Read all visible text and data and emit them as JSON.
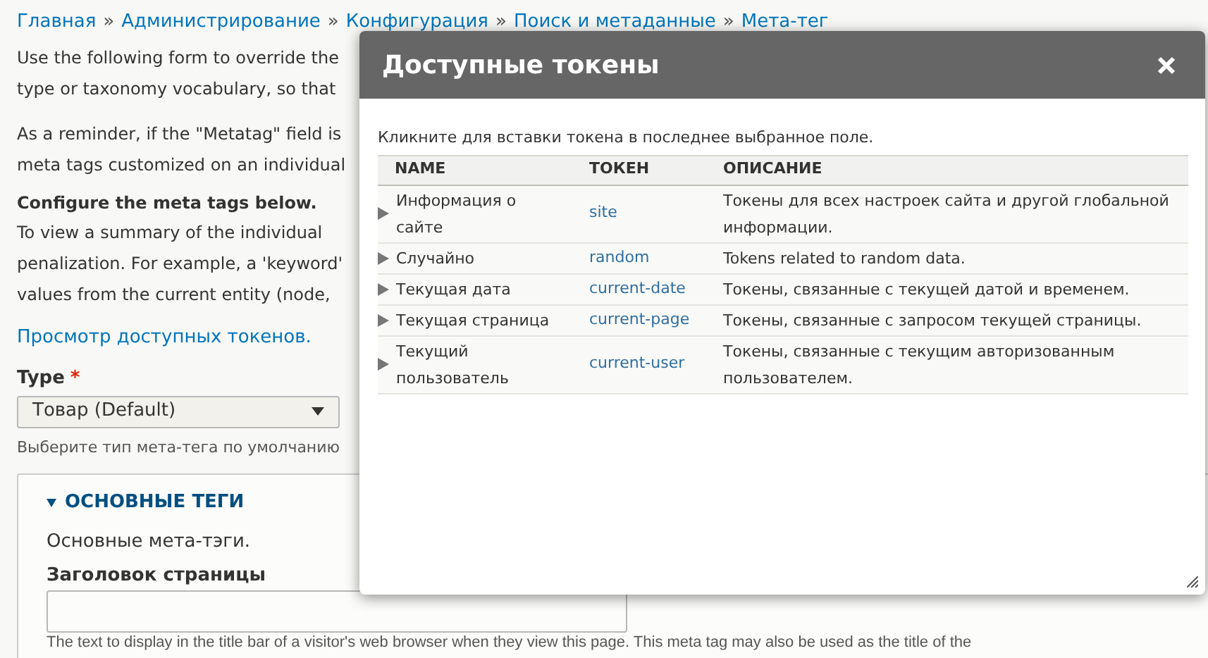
{
  "breadcrumb": [
    {
      "label": "Главная"
    },
    {
      "label": "Администрирование"
    },
    {
      "label": "Конфигурация"
    },
    {
      "label": "Поиск и метаданные"
    },
    {
      "label": "Мета-тег"
    }
  ],
  "breadcrumb_separator": "»",
  "intro_paragraphs": [
    {
      "lines": [
        "Use the following form to override the",
        "type or taxonomy vocabulary, so that"
      ]
    },
    {
      "lines": [
        "As a reminder, if the \"Metatag\" field is",
        "meta tags customized on an individual"
      ]
    }
  ],
  "configure": {
    "heading": "Configure the meta tags below.",
    "lines": [
      "To view a summary of the individual",
      "penalization. For example, a 'keyword'",
      "values from the current entity (node,"
    ]
  },
  "tokens_link": "Просмотр доступных токенов.",
  "type_field": {
    "label": "Type",
    "required": true,
    "required_mark": "*",
    "value": "Товар (Default)",
    "hint": "Выберите тип мета-тега по умолчанию"
  },
  "details": {
    "title": "ОСНОВНЫЕ ТЕГИ",
    "expanded": true,
    "description": "Основные мета-тэги.",
    "field_label": "Заголовок страницы",
    "field_help": "The text to display in the title bar of a visitor's web browser when they view this page. This meta tag may also be used as the title of the"
  },
  "dialog": {
    "title": "Доступные токены",
    "instructions": "Кликните для вставки токена в последнее выбранное поле.",
    "columns": [
      "NAME",
      "ТОКЕН",
      "ОПИСАНИЕ"
    ],
    "rows": [
      {
        "name": "Информация о сайте",
        "token": "site",
        "description": "Токены для всех настроек сайта и другой глобальной информации.",
        "expanded": false
      },
      {
        "name": "Случайно",
        "token": "random",
        "description": "Tokens related to random data.",
        "expanded": false
      },
      {
        "name": "Текущая дата",
        "token": "current-date",
        "description": "Токены, связанные с текущей датой и временем.",
        "expanded": false
      },
      {
        "name": "Текущая страница",
        "token": "current-page",
        "description": "Токены, связанные с запросом текущей страницы.",
        "expanded": false
      },
      {
        "name": "Текущий пользователь",
        "token": "current-user",
        "description": "Токены, связанные с текущим авторизованным пользователем.",
        "expanded": false
      }
    ]
  }
}
